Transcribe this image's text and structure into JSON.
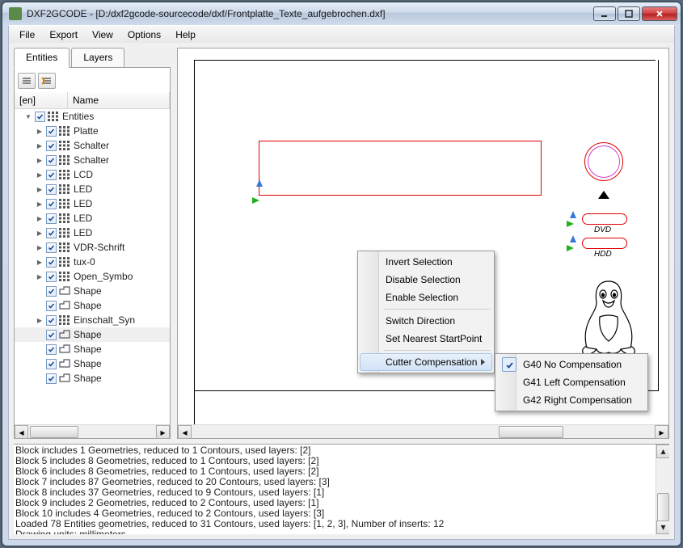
{
  "window": {
    "title": "DXF2GCODE - [D:/dxf2gcode-sourcecode/dxf/Frontplatte_Texte_aufgebrochen.dxf]"
  },
  "menu": {
    "items": [
      "File",
      "Export",
      "View",
      "Options",
      "Help"
    ]
  },
  "tabs": {
    "entities": "Entities",
    "layers": "Layers"
  },
  "tree": {
    "header_en": "[en]",
    "header_name": "Name",
    "items": [
      {
        "indent": 0,
        "exp": "down",
        "icon": "grid",
        "name": "Entities"
      },
      {
        "indent": 1,
        "exp": "right",
        "icon": "grid",
        "name": "Platte"
      },
      {
        "indent": 1,
        "exp": "right",
        "icon": "grid",
        "name": "Schalter"
      },
      {
        "indent": 1,
        "exp": "right",
        "icon": "grid",
        "name": "Schalter"
      },
      {
        "indent": 1,
        "exp": "right",
        "icon": "grid",
        "name": "LCD"
      },
      {
        "indent": 1,
        "exp": "right",
        "icon": "grid",
        "name": "LED"
      },
      {
        "indent": 1,
        "exp": "right",
        "icon": "grid",
        "name": "LED"
      },
      {
        "indent": 1,
        "exp": "right",
        "icon": "grid",
        "name": "LED"
      },
      {
        "indent": 1,
        "exp": "right",
        "icon": "grid",
        "name": "LED"
      },
      {
        "indent": 1,
        "exp": "right",
        "icon": "grid",
        "name": "VDR-Schrift"
      },
      {
        "indent": 1,
        "exp": "right",
        "icon": "grid",
        "name": "tux-0"
      },
      {
        "indent": 1,
        "exp": "right",
        "icon": "grid",
        "name": "Open_Symbo"
      },
      {
        "indent": 1,
        "exp": "none",
        "icon": "shape",
        "name": "Shape"
      },
      {
        "indent": 1,
        "exp": "none",
        "icon": "shape",
        "name": "Shape"
      },
      {
        "indent": 1,
        "exp": "right",
        "icon": "grid",
        "name": "Einschalt_Syn"
      },
      {
        "indent": 1,
        "exp": "none",
        "icon": "shape",
        "name": "Shape",
        "sel": true
      },
      {
        "indent": 1,
        "exp": "none",
        "icon": "shape",
        "name": "Shape"
      },
      {
        "indent": 1,
        "exp": "none",
        "icon": "shape",
        "name": "Shape"
      },
      {
        "indent": 1,
        "exp": "none",
        "icon": "shape",
        "name": "Shape"
      }
    ]
  },
  "canvas_labels": {
    "dvd": "DVD",
    "hdd": "HDD"
  },
  "context1": {
    "invert": "Invert Selection",
    "disable": "Disable Selection",
    "enable": "Enable Selection",
    "switch": "Switch Direction",
    "nearest": "Set Nearest StartPoint",
    "cutter": "Cutter Compensation"
  },
  "context2": {
    "g40": "G40 No Compensation",
    "g41": "G41 Left Compensation",
    "g42": "G42 Right Compensation"
  },
  "log": [
    "Block  includes 1 Geometries, reduced to 1 Contours, used layers: [2]",
    "Block 5 includes 8 Geometries, reduced to 1 Contours, used layers: [2]",
    "Block 6 includes 8 Geometries, reduced to 1 Contours, used layers: [2]",
    "Block 7 includes 87 Geometries, reduced to 20 Contours, used layers: [3]",
    "Block 8 includes 37 Geometries, reduced to 9 Contours, used layers: [1]",
    "Block 9 includes 2 Geometries, reduced to 2 Contours, used layers: [1]",
    "Block 10 includes 4 Geometries, reduced to 2 Contours, used layers: [3]",
    "Loaded 78 Entities geometries, reduced to 31 Contours, used layers: [1, 2, 3], Number of inserts: 12",
    "Drawing units: millimeters"
  ]
}
